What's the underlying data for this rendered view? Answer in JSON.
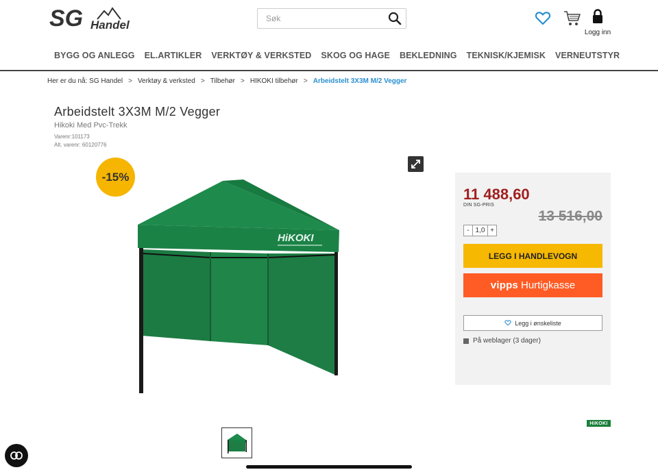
{
  "header": {
    "logo_main": "SG",
    "logo_sub": "Handel",
    "search_placeholder": "Søk",
    "login_label": "Logg inn"
  },
  "nav": {
    "items": [
      "BYGG OG ANLEGG",
      "EL.ARTIKLER",
      "VERKTØY & VERKSTED",
      "SKOG OG HAGE",
      "BEKLEDNING",
      "TEKNISK/KJEMISK",
      "VERNEUTSTYR"
    ]
  },
  "breadcrumb": {
    "prefix": "Her er du nå:",
    "items": [
      "SG Handel",
      "Verktøy & verksted",
      "Tilbehør",
      "HIKOKI tilbehør"
    ],
    "current": "Arbeidstelt 3X3M M/2 Vegger",
    "separator": ">"
  },
  "product": {
    "title": "Arbeidstelt 3X3M M/2 Vegger",
    "subtitle": "Hikoki Med Pvc-Trekk",
    "varenr_label": "Varenr:",
    "varenr": "101173",
    "alt_varenr_label": "Alt. varenr:",
    "alt_varenr": "60120776",
    "discount_badge": "-15%",
    "image_print": "HiKOKI",
    "brand_logo_text": "HiKOKI"
  },
  "purchase": {
    "price": "11 488,60",
    "price_label": "DIN SG-PRIS",
    "old_price": "13 516,00",
    "qty_minus": "-",
    "qty_value": "1,0",
    "qty_plus": "+",
    "add_to_cart": "LEGG I HANDLEVOGN",
    "vipps_brand": "vipps",
    "vipps_label": "Hurtigkasse",
    "wishlist": "Legg i ønskeliste",
    "stock": "På weblager (3 dager)"
  },
  "colors": {
    "accent_link": "#2a8fd0",
    "price_red": "#a01f1f",
    "cta_yellow": "#f6b800",
    "vipps_orange": "#ff5b24",
    "tent_green": "#1e8a4c",
    "badge_yellow": "#f5b500"
  },
  "icons": {
    "search": "search-icon",
    "wishlist": "heart-icon",
    "cart": "cart-icon",
    "login": "lock-icon",
    "expand": "expand-icon",
    "chat": "chat-icon"
  }
}
